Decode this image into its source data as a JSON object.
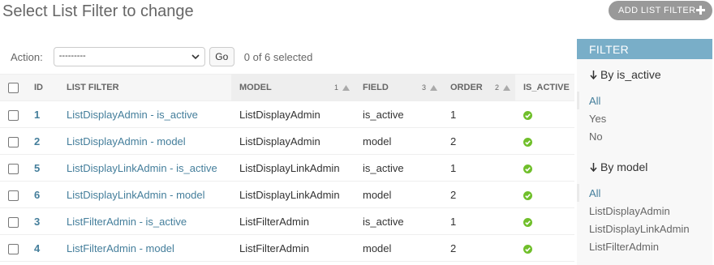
{
  "header": {
    "title": "Select List Filter to change",
    "add_button": "ADD LIST FILTER"
  },
  "actions": {
    "label": "Action:",
    "select_value": "---------",
    "go_label": "Go",
    "selected_text": "0 of 6 selected"
  },
  "table": {
    "columns": [
      {
        "label": "ID"
      },
      {
        "label": "LIST FILTER"
      },
      {
        "label": "MODEL",
        "sort_priority": "1"
      },
      {
        "label": "FIELD",
        "sort_priority": "3"
      },
      {
        "label": "ORDER",
        "sort_priority": "2"
      },
      {
        "label": "IS_ACTIVE"
      }
    ],
    "rows": [
      {
        "id": "1",
        "name": "ListDisplayAdmin - is_active",
        "model": "ListDisplayAdmin",
        "field": "is_active",
        "order": "1",
        "is_active": true
      },
      {
        "id": "2",
        "name": "ListDisplayAdmin - model",
        "model": "ListDisplayAdmin",
        "field": "model",
        "order": "2",
        "is_active": true
      },
      {
        "id": "5",
        "name": "ListDisplayLinkAdmin - is_active",
        "model": "ListDisplayLinkAdmin",
        "field": "is_active",
        "order": "1",
        "is_active": true
      },
      {
        "id": "6",
        "name": "ListDisplayLinkAdmin - model",
        "model": "ListDisplayLinkAdmin",
        "field": "model",
        "order": "2",
        "is_active": true
      },
      {
        "id": "3",
        "name": "ListFilterAdmin - is_active",
        "model": "ListFilterAdmin",
        "field": "is_active",
        "order": "1",
        "is_active": true
      },
      {
        "id": "4",
        "name": "ListFilterAdmin - model",
        "model": "ListFilterAdmin",
        "field": "model",
        "order": "2",
        "is_active": true
      }
    ]
  },
  "filter": {
    "heading": "FILTER",
    "sections": [
      {
        "title": "By is_active",
        "options": [
          "All",
          "Yes",
          "No"
        ],
        "selected": "All"
      },
      {
        "title": "By model",
        "options": [
          "All",
          "ListDisplayAdmin",
          "ListDisplayLinkAdmin",
          "ListFilterAdmin"
        ],
        "selected": "All"
      }
    ]
  },
  "colors": {
    "link": "#447e9b",
    "filter_header": "#79aec8",
    "active_check": "#70bf2b",
    "add_button": "#999999"
  },
  "icons": [
    "plus-icon",
    "chevron-down-icon",
    "sort-ascending-icon",
    "check-circle-icon",
    "arrow-down-icon"
  ]
}
